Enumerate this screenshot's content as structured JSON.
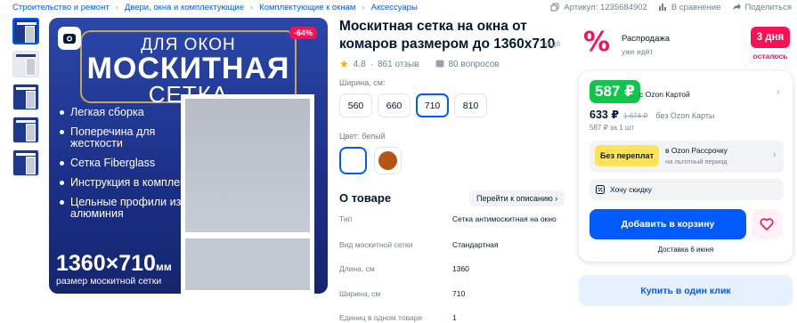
{
  "breadcrumbs": [
    "Строительство и ремонт",
    "Двери, окна и комплектующие",
    "Комплектующие к окнам",
    "Аксессуары"
  ],
  "header": {
    "article": "Артикул: 1235684902",
    "compare": "В сравнение",
    "share": "Поделиться"
  },
  "image": {
    "badge": "-64%",
    "line1": "ДЛЯ ОКОН",
    "line2": "МОСКИТНАЯ",
    "line3": "СЕТКА",
    "features": [
      "Легкая сборка",
      "Поперечина для жесткости",
      "Сетка Fiberglass",
      "Инструкция в комплекте",
      "Цельные профили из алюминия"
    ],
    "size": "1360×710",
    "size_unit": "мм",
    "size_caption": "размер москитной сетки",
    "thumbnail_count": 5
  },
  "product": {
    "title": "Москитная сетка на окна от комаров размером до 1360x710",
    "more": "ещё",
    "rating": "4.8",
    "reviews": "861 отзыв",
    "questions": "80 вопросов",
    "width_label": "Ширина, см:",
    "widths": [
      "560",
      "660",
      "710",
      "810"
    ],
    "selected_width": "710",
    "color_label": "Цвет: белый",
    "colors": [
      {
        "name": "белый",
        "hex": "#ffffff"
      },
      {
        "name": "коричневый",
        "hex": "#b4560f"
      }
    ],
    "about_title": "О товаре",
    "about_link": "Перейти к описанию",
    "specs": [
      {
        "key": "Тип",
        "value": "Сетка антимоскитная на окно"
      },
      {
        "key": "Вид москитной сетки",
        "value": "Стандартная"
      },
      {
        "key": "Длина, см",
        "value": "1360"
      },
      {
        "key": "Ширина, см",
        "value": "710"
      },
      {
        "key": "Единиц в одном товаре",
        "value": "1"
      }
    ]
  },
  "promo": {
    "title": "Распродажа",
    "subtitle": "уже идёт",
    "days": "3 дня",
    "left": "осталось"
  },
  "buy": {
    "price_card": "587 ₽",
    "card_label": "с Ozon Картой",
    "price": "633 ₽",
    "old_price": "1 674 ₽",
    "no_card": "без Ozon Карты",
    "per_unit": "587 ₽ за 1 шт",
    "installment_badge": "Без переплат",
    "installment_title": "в Ozon Рассрочку",
    "installment_sub": "на льготный период",
    "wish": "Хочу скидку",
    "cart": "Добавить в корзину",
    "delivery": "Доставка 6 июня",
    "one_click": "Купить в один клик"
  },
  "colors": {
    "accent": "#005bff",
    "sale": "#f91155",
    "green": "#10c44c"
  }
}
